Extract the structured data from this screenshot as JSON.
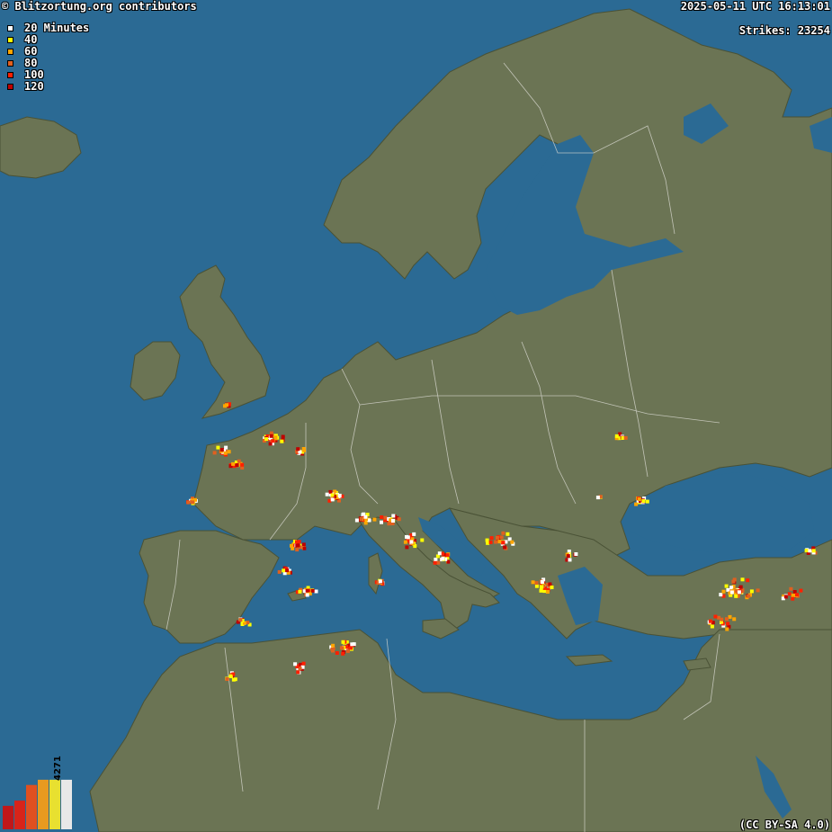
{
  "header": {
    "attribution": "© Blitzortung.org contributors",
    "timestamp": "2025-05-11 UTC 16:13:01",
    "strikes_label": "Strikes: 23254"
  },
  "legend": [
    {
      "label": "20 Minutes",
      "color": "#ffffff"
    },
    {
      "label": "40",
      "color": "#ffff00"
    },
    {
      "label": "60",
      "color": "#ffa500"
    },
    {
      "label": "80",
      "color": "#e06020"
    },
    {
      "label": "100",
      "color": "#ff2000"
    },
    {
      "label": "120",
      "color": "#c00000"
    }
  ],
  "histogram": {
    "peak_value": "4271",
    "bars": [
      {
        "color": "#c0171a",
        "value": 0.45
      },
      {
        "color": "#d8241a",
        "value": 0.55
      },
      {
        "color": "#e05020",
        "value": 0.85
      },
      {
        "color": "#e89a20",
        "value": 0.95
      },
      {
        "color": "#e8e030",
        "value": 0.95
      },
      {
        "color": "#e8e8e8",
        "value": 0.95
      }
    ]
  },
  "license": "(CC BY-SA 4.0)",
  "colors": {
    "sea": "#2b6a94",
    "land": "#6b7454",
    "land_dark": "#5e6548",
    "border": "#d8d8d0"
  }
}
